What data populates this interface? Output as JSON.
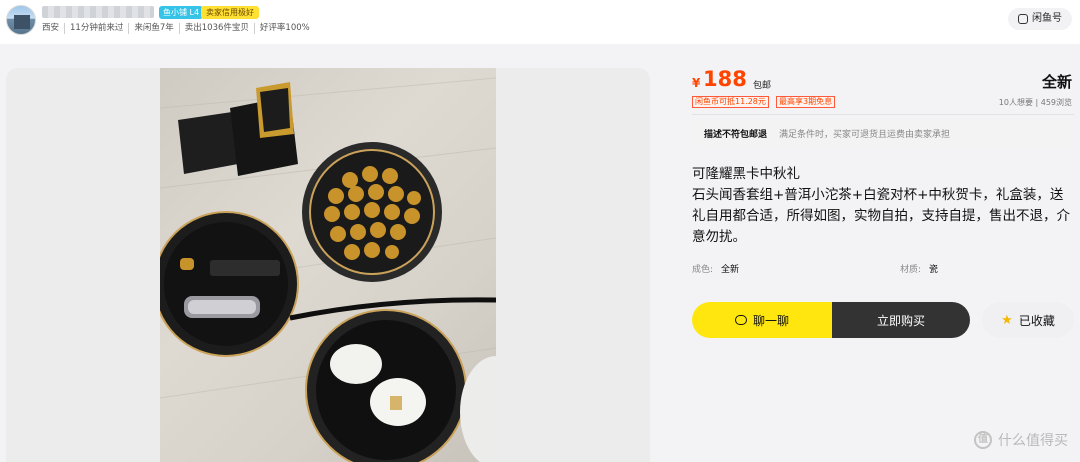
{
  "seller": {
    "level_badge": "鱼小铺 L4",
    "credit_badge": "卖家信用极好",
    "stats": [
      "西安",
      "11分钟前来过",
      "来闲鱼7年",
      "卖出1036件宝贝",
      "好评率100%"
    ]
  },
  "header": {
    "xianyu_label": "闲鱼号"
  },
  "product": {
    "currency": "¥",
    "price": "188",
    "shipping": "包邮",
    "condition_top": "全新",
    "tags": [
      "闲鱼币可抵11.28元",
      "最高享3期免息"
    ],
    "want_stats": "10人想要 | 459浏览",
    "policy_title": "描述不符包邮退",
    "policy_desc": "满足条件时，买家可退货且运费由卖家承担",
    "description": "可隆耀黑卡中秋礼\n石头闻香套组+普洱小沱茶+白瓷对杯+中秋贺卡，礼盒装，送礼自用都合适，所得如图，实物自拍，支持自提，售出不退，介意勿扰。",
    "attributes": [
      {
        "key": "成色:",
        "value": "全新"
      },
      {
        "key": "材质:",
        "value": "瓷"
      }
    ]
  },
  "actions": {
    "chat_label": "聊一聊",
    "buy_label": "立即购买",
    "favorite_label": "已收藏"
  },
  "watermark": {
    "text": "什么值得买",
    "logo": "值"
  },
  "colors": {
    "accent_yellow": "#ffe60f",
    "price_orange": "#ff4400",
    "buy_dark": "#333333"
  }
}
